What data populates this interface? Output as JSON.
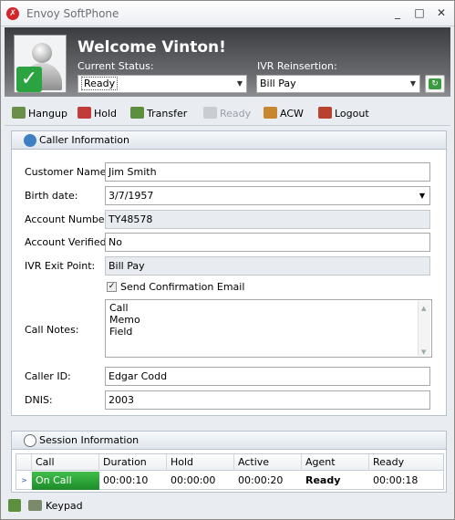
{
  "window": {
    "title": "Envoy SoftPhone",
    "minimize": "_",
    "maximize": "□",
    "close": "✕"
  },
  "header": {
    "welcome": "Welcome Vinton!",
    "status_label": "Current Status:",
    "status_value": "Ready",
    "ivr_label": "IVR Reinsertion:",
    "ivr_value": "Bill Pay"
  },
  "toolbar": {
    "hangup": "Hangup",
    "hold": "Hold",
    "transfer": "Transfer",
    "ready": "Ready",
    "acw": "ACW",
    "logout": "Logout"
  },
  "caller": {
    "heading": "Caller Information",
    "customer_name_label": "Customer Name:",
    "customer_name": "Jim Smith",
    "birth_date_label": "Birth date:",
    "birth_date": "3/7/1957",
    "account_number_label": "Account Number:",
    "account_number": "TY48578",
    "account_verified_label": "Account Verified:",
    "account_verified": "No",
    "ivr_exit_label": "IVR Exit Point:",
    "ivr_exit": "Bill Pay",
    "send_email_label": "Send Confirmation Email",
    "send_email_checked": true,
    "call_notes_label": "Call Notes:",
    "call_notes": [
      "Call",
      "Memo",
      "Field"
    ],
    "caller_id_label": "Caller ID:",
    "caller_id": "Edgar Codd",
    "dnis_label": "DNIS:",
    "dnis": "2003"
  },
  "session": {
    "heading": "Session Information",
    "columns": [
      "Call",
      "Duration",
      "Hold",
      "Active",
      "Agent",
      "Ready"
    ],
    "row": {
      "call": "On Call",
      "duration": "00:00:10",
      "hold": "00:00:00",
      "active": "00:00:20",
      "agent": "Ready",
      "ready": "00:00:18"
    }
  },
  "statusbar": {
    "keypad": "Keypad"
  },
  "colors": {
    "header_dark": "#3b3d40",
    "on_call_green": "#2ea83b",
    "panel_border": "#b7c1cd"
  },
  "icons": {
    "app": "envoy-logo-icon",
    "hangup": "phone-hangup-icon",
    "hold": "phone-hold-icon",
    "transfer": "phone-transfer-icon",
    "ready": "phone-ready-icon",
    "acw": "agent-icon",
    "logout": "logout-icon",
    "caller": "person-icon",
    "session": "clock-icon",
    "keypad": "keypad-icon"
  }
}
